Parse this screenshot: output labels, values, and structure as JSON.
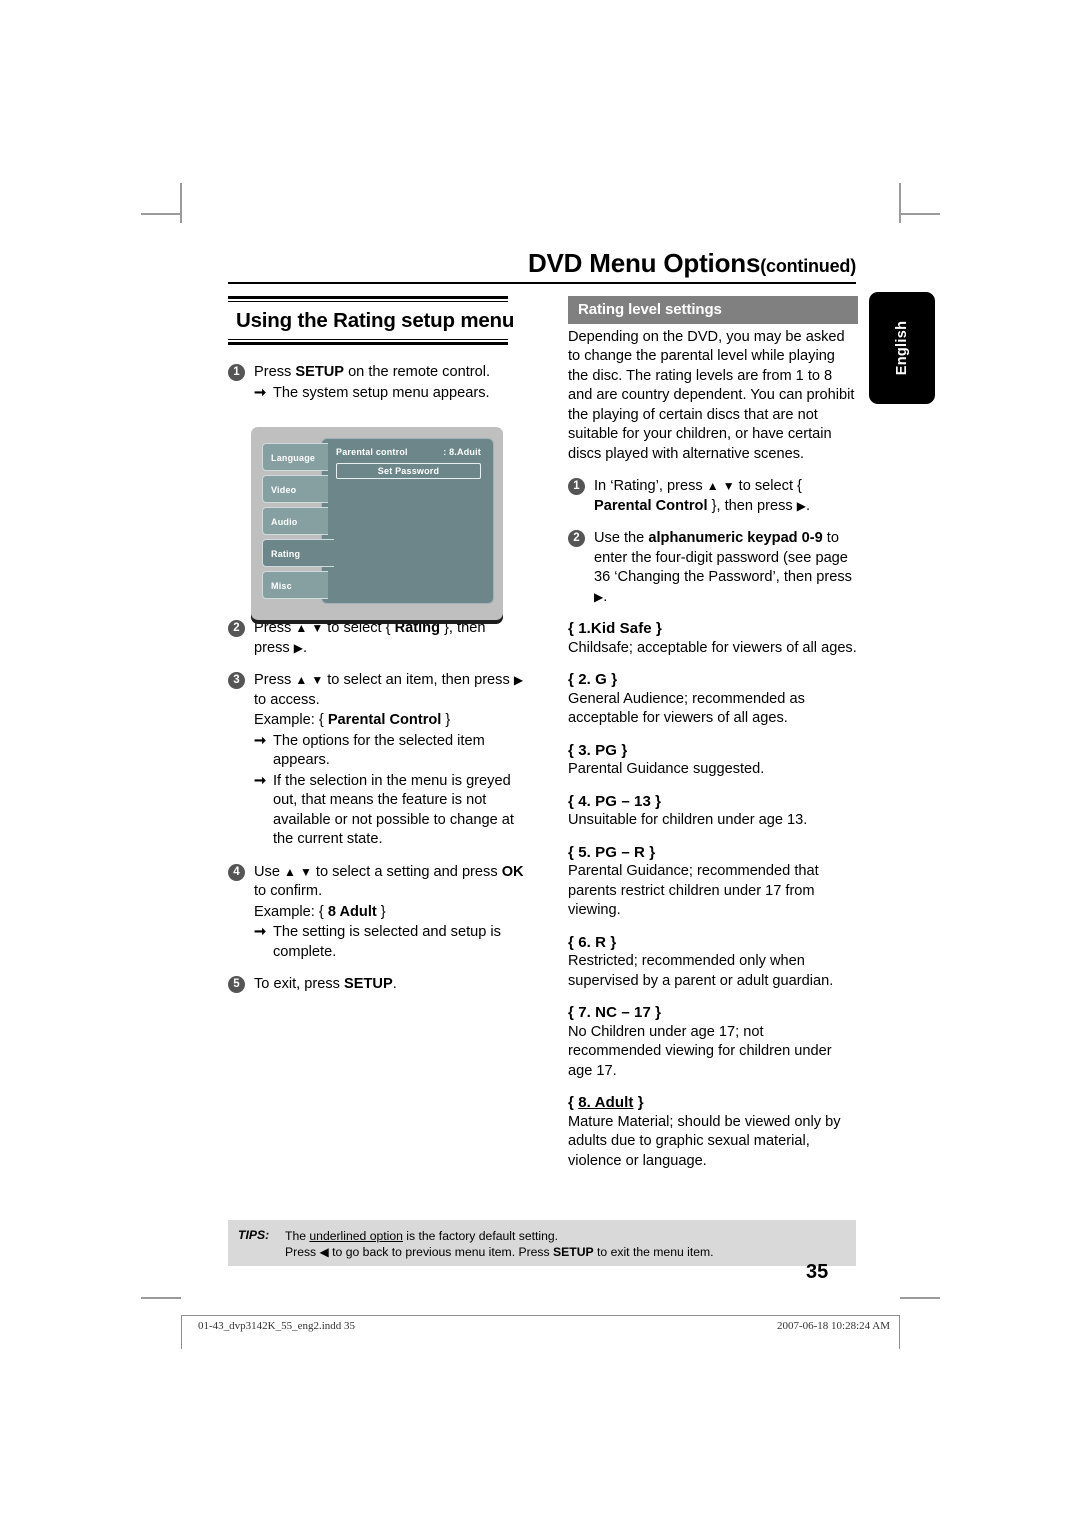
{
  "header": {
    "title": "DVD Menu Options",
    "continued": "(continued)"
  },
  "language_tab": {
    "label": "English"
  },
  "left_column": {
    "section_title": "Using the Rating setup menu",
    "steps": [
      {
        "num": "1",
        "text_parts": [
          "Press ",
          "SETUP",
          " on the remote control."
        ],
        "arrows": [
          "The system setup menu appears."
        ]
      },
      {
        "num": "2",
        "text": "Press ▲ ▼ to select { Rating }, then press ▶.",
        "bold": "Rating"
      },
      {
        "num": "3",
        "text": "Press ▲ ▼ to select an item, then press ▶ to access.",
        "example": "Example: { Parental Control }",
        "example_bold": "Parental Control",
        "arrows": [
          "The options for the selected item appears.",
          "If the selection in the menu is greyed out, that means the feature is not available or not possible to change at the current state."
        ]
      },
      {
        "num": "4",
        "text": "Use ▲ ▼ to select a setting and press OK to confirm.",
        "bold": "OK",
        "example": "Example: { 8 Adult }",
        "example_bold": "8 Adult",
        "arrows": [
          "The setting is selected and setup is complete."
        ]
      },
      {
        "num": "5",
        "text": "To exit, press SETUP.",
        "bold": "SETUP"
      }
    ]
  },
  "osd_menu": {
    "tabs": [
      {
        "label": "Language",
        "selected": false
      },
      {
        "label": "Video",
        "selected": false
      },
      {
        "label": "Audio",
        "selected": false
      },
      {
        "label": "Rating",
        "selected": true
      },
      {
        "label": "Misc",
        "selected": false
      }
    ],
    "row_label": "Parental control",
    "row_value": ": 8.Aduit",
    "button_label": "Set Password"
  },
  "right_column": {
    "heading": "Rating level settings",
    "intro": "Depending on the DVD, you may be asked to change the parental level while playing the disc. The rating levels are from 1 to 8 and are country dependent. You can prohibit the playing of certain discs that are not suitable for your children, or have certain discs played with alternative scenes.",
    "steps": [
      {
        "num": "1",
        "pre": "In ‘Rating’, press ▲ ▼ to select { ",
        "bold": "Parental Control",
        "post": " }, then press ▶."
      },
      {
        "num": "2",
        "pre": "Use the ",
        "bold": "alphanumeric keypad 0-9",
        "post": " to enter the four-digit password (see page 36 ‘Changing the Password’, then press ▶."
      }
    ],
    "levels": [
      {
        "title": "{ 1.Kid Safe }",
        "label": "1.Kid Safe",
        "underlined": false,
        "desc": "Childsafe; acceptable for viewers of all ages."
      },
      {
        "title": "{ 2. G }",
        "label": "2. G",
        "underlined": false,
        "desc": "General Audience; recommended as acceptable for viewers of all ages."
      },
      {
        "title": "{ 3. PG }",
        "label": "3. PG",
        "underlined": false,
        "desc": "Parental Guidance suggested."
      },
      {
        "title": "{ 4. PG – 13 }",
        "label": "4. PG – 13",
        "underlined": false,
        "desc": "Unsuitable for children under age 13."
      },
      {
        "title": "{ 5. PG – R }",
        "label": "5. PG – R",
        "underlined": false,
        "desc": "Parental Guidance; recommended that parents restrict children under 17 from viewing."
      },
      {
        "title": "{ 6. R }",
        "label": "6. R",
        "underlined": false,
        "desc": "Restricted; recommended only when supervised by a parent or adult guardian."
      },
      {
        "title": "{ 7. NC – 17 }",
        "label": "7. NC – 17",
        "underlined": false,
        "desc": "No Children under age 17; not recommended viewing for children under age 17."
      },
      {
        "title": "{ 8. Adult }",
        "label": "8. Adult",
        "underlined": true,
        "desc": "Mature Material; should be viewed only by adults due to graphic sexual material, violence or language."
      }
    ]
  },
  "tips": {
    "label": "TIPS:",
    "line1_pre": "The ",
    "line1_underline": "underlined option",
    "line1_post": " is the factory default setting.",
    "line2_a": "Press ◀ to go back to previous menu item. Press ",
    "line2_bold": "SETUP",
    "line2_b": " to exit the menu item."
  },
  "page_number": "35",
  "footer": {
    "file": "01-43_dvp3142K_55_eng2.indd   35",
    "date": "2007-06-18   10:28:24 AM"
  }
}
